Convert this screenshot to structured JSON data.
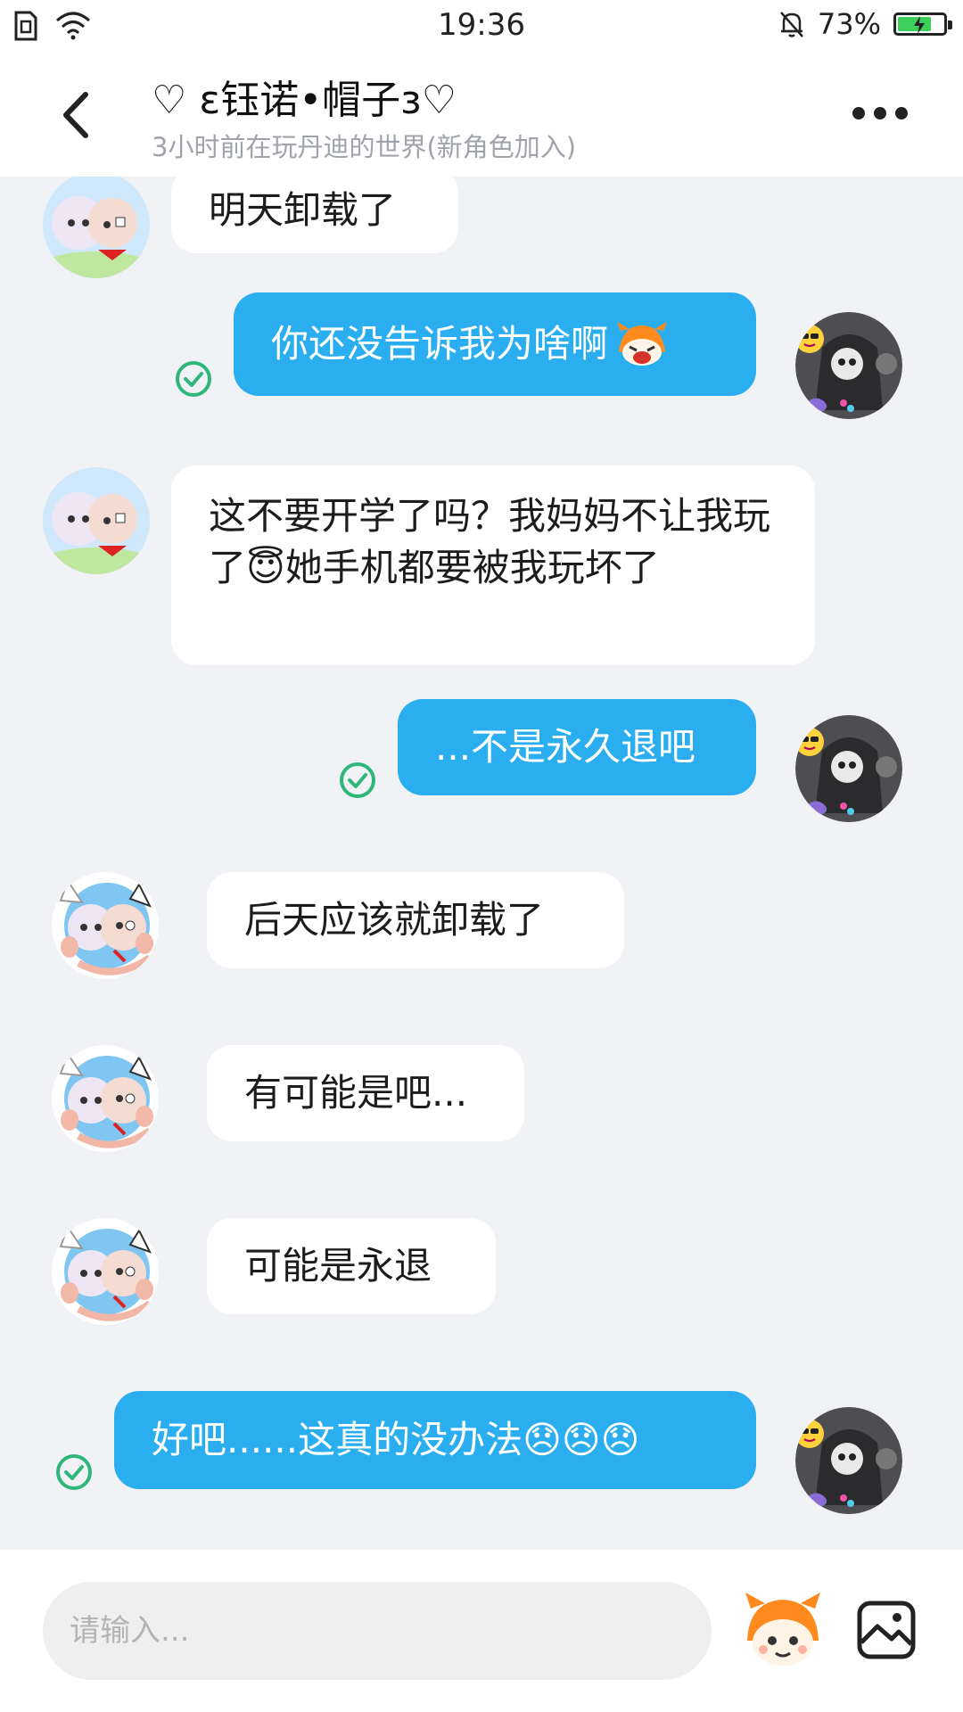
{
  "status_bar": {
    "time": "19:36",
    "battery_text": "73%",
    "battery_level": 0.73
  },
  "header": {
    "title": "♡ ε钰诺•帽子з♡",
    "subtitle": "3小时前在玩丹迪的世界(新角色加入)"
  },
  "messages": [
    {
      "side": "in",
      "text": "明天卸载了",
      "status": ""
    },
    {
      "side": "out",
      "text": "你还没告诉我为啥啊",
      "emoji": [
        "dandi-cry-sticker"
      ],
      "status": "read"
    },
    {
      "side": "in",
      "text": "这不要开学了吗？我妈妈不让我玩了😇她手机都要被我玩坏了",
      "status": ""
    },
    {
      "side": "out",
      "text": "...不是永久退吧",
      "status": "read"
    },
    {
      "side": "in",
      "text": "后天应该就卸载了",
      "status": ""
    },
    {
      "side": "in",
      "text": "有可能是吧...",
      "status": ""
    },
    {
      "side": "in",
      "text": "可能是永退",
      "status": ""
    },
    {
      "side": "out",
      "text": "好吧......这真的没办法😞😞😞",
      "status": "read"
    }
  ],
  "input": {
    "placeholder": "请输入..."
  },
  "colors": {
    "outgoing_bubble": "#2aaeef",
    "incoming_bubble": "#ffffff",
    "read_check": "#2fb67a",
    "background": "#f0f2f5"
  },
  "icons": [
    "back-arrow-icon",
    "more-icon",
    "read-check-icon",
    "dandi-emoji-icon",
    "image-icon",
    "wifi-icon",
    "sim-icon",
    "mute-bell-icon",
    "battery-icon"
  ]
}
